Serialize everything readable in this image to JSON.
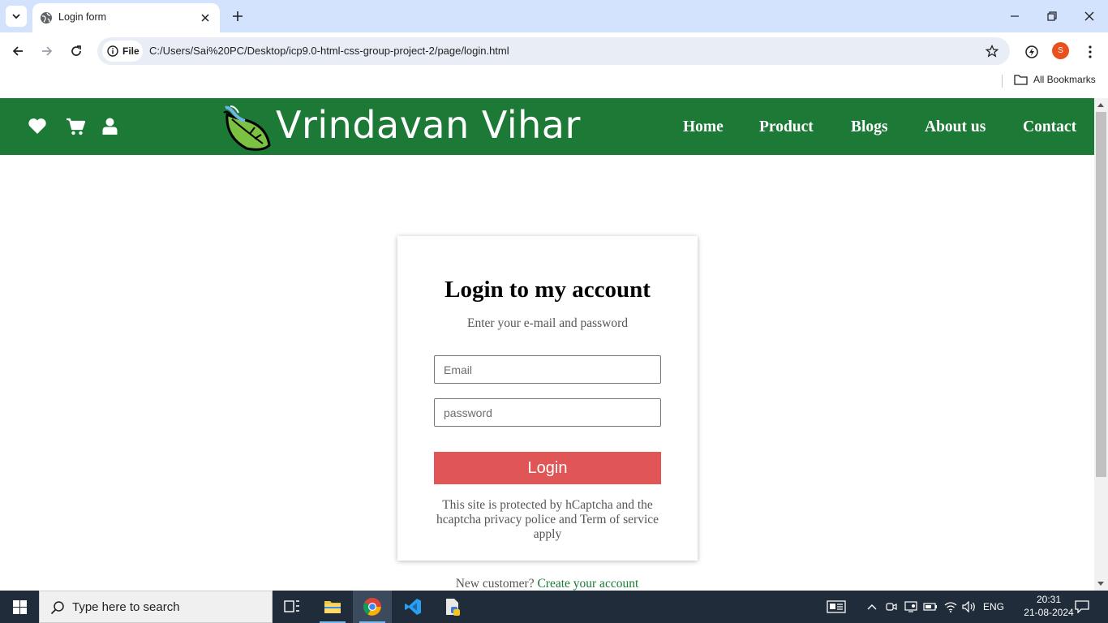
{
  "browser": {
    "tab_title": "Login form",
    "site_chip_label": "File",
    "url": "C:/Users/Sai%20PC/Desktop/icp9.0-html-css-group-project-2/page/login.html",
    "profile_initial": "S",
    "bookmarks_label": "All Bookmarks"
  },
  "site": {
    "brand": "Vrindavan Vihar",
    "header_icons": [
      "heart-icon",
      "cart-icon",
      "user-icon"
    ],
    "nav": {
      "home": "Home",
      "product": "Product",
      "blogs": "Blogs",
      "about": "About us",
      "contact": "Contact"
    },
    "colors": {
      "header_bg": "#1c7936",
      "login_button": "#e05555"
    }
  },
  "login": {
    "title": "Login to my account",
    "subtitle": "Enter your e-mail and password",
    "email_placeholder": "Email",
    "password_placeholder": "password",
    "button_label": "Login",
    "captcha_note": "This site is protected by hCaptcha and the hcaptcha privacy police and Term of service apply",
    "new_customer_text": "New customer?",
    "create_account_link": "Create your account"
  },
  "taskbar": {
    "search_placeholder": "Type here to search",
    "language": "ENG",
    "time": "20:31",
    "date": "21-08-2024"
  }
}
